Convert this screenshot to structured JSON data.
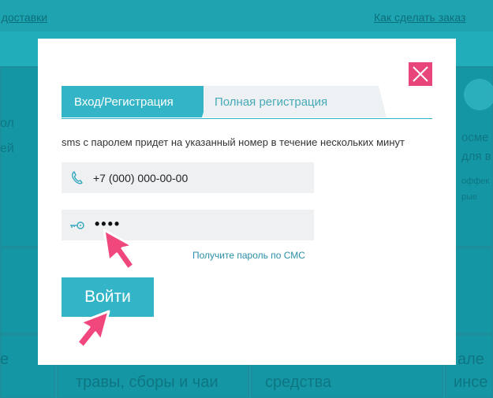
{
  "background": {
    "top_left_link": "и доставки",
    "top_right_link": "Как сделать заказ",
    "tile_texts": [
      "травы, сборы и чаи",
      "средства",
      "е",
      "але",
      "инсе"
    ],
    "side_texts": [
      "осме",
      "для в",
      "оффек",
      "рые",
      "ол",
      "ей"
    ]
  },
  "modal": {
    "tabs": [
      {
        "label": "Вход/Регистрация",
        "active": true
      },
      {
        "label": "Полная регистрация",
        "active": false
      }
    ],
    "hint": "sms с паролем придет на указанный номер в течение нескольких минут",
    "phone_value": "+7 (000) 000-00-00",
    "password_value": "••••",
    "sms_link": "Получите пароль по СМС",
    "login_button": "Войти"
  },
  "colors": {
    "accent": "#34b5c7",
    "close": "#e8457a",
    "arrow": "#f0477d"
  },
  "icons": [
    "close-icon",
    "phone-icon",
    "key-icon",
    "pointer-arrow-icon"
  ]
}
